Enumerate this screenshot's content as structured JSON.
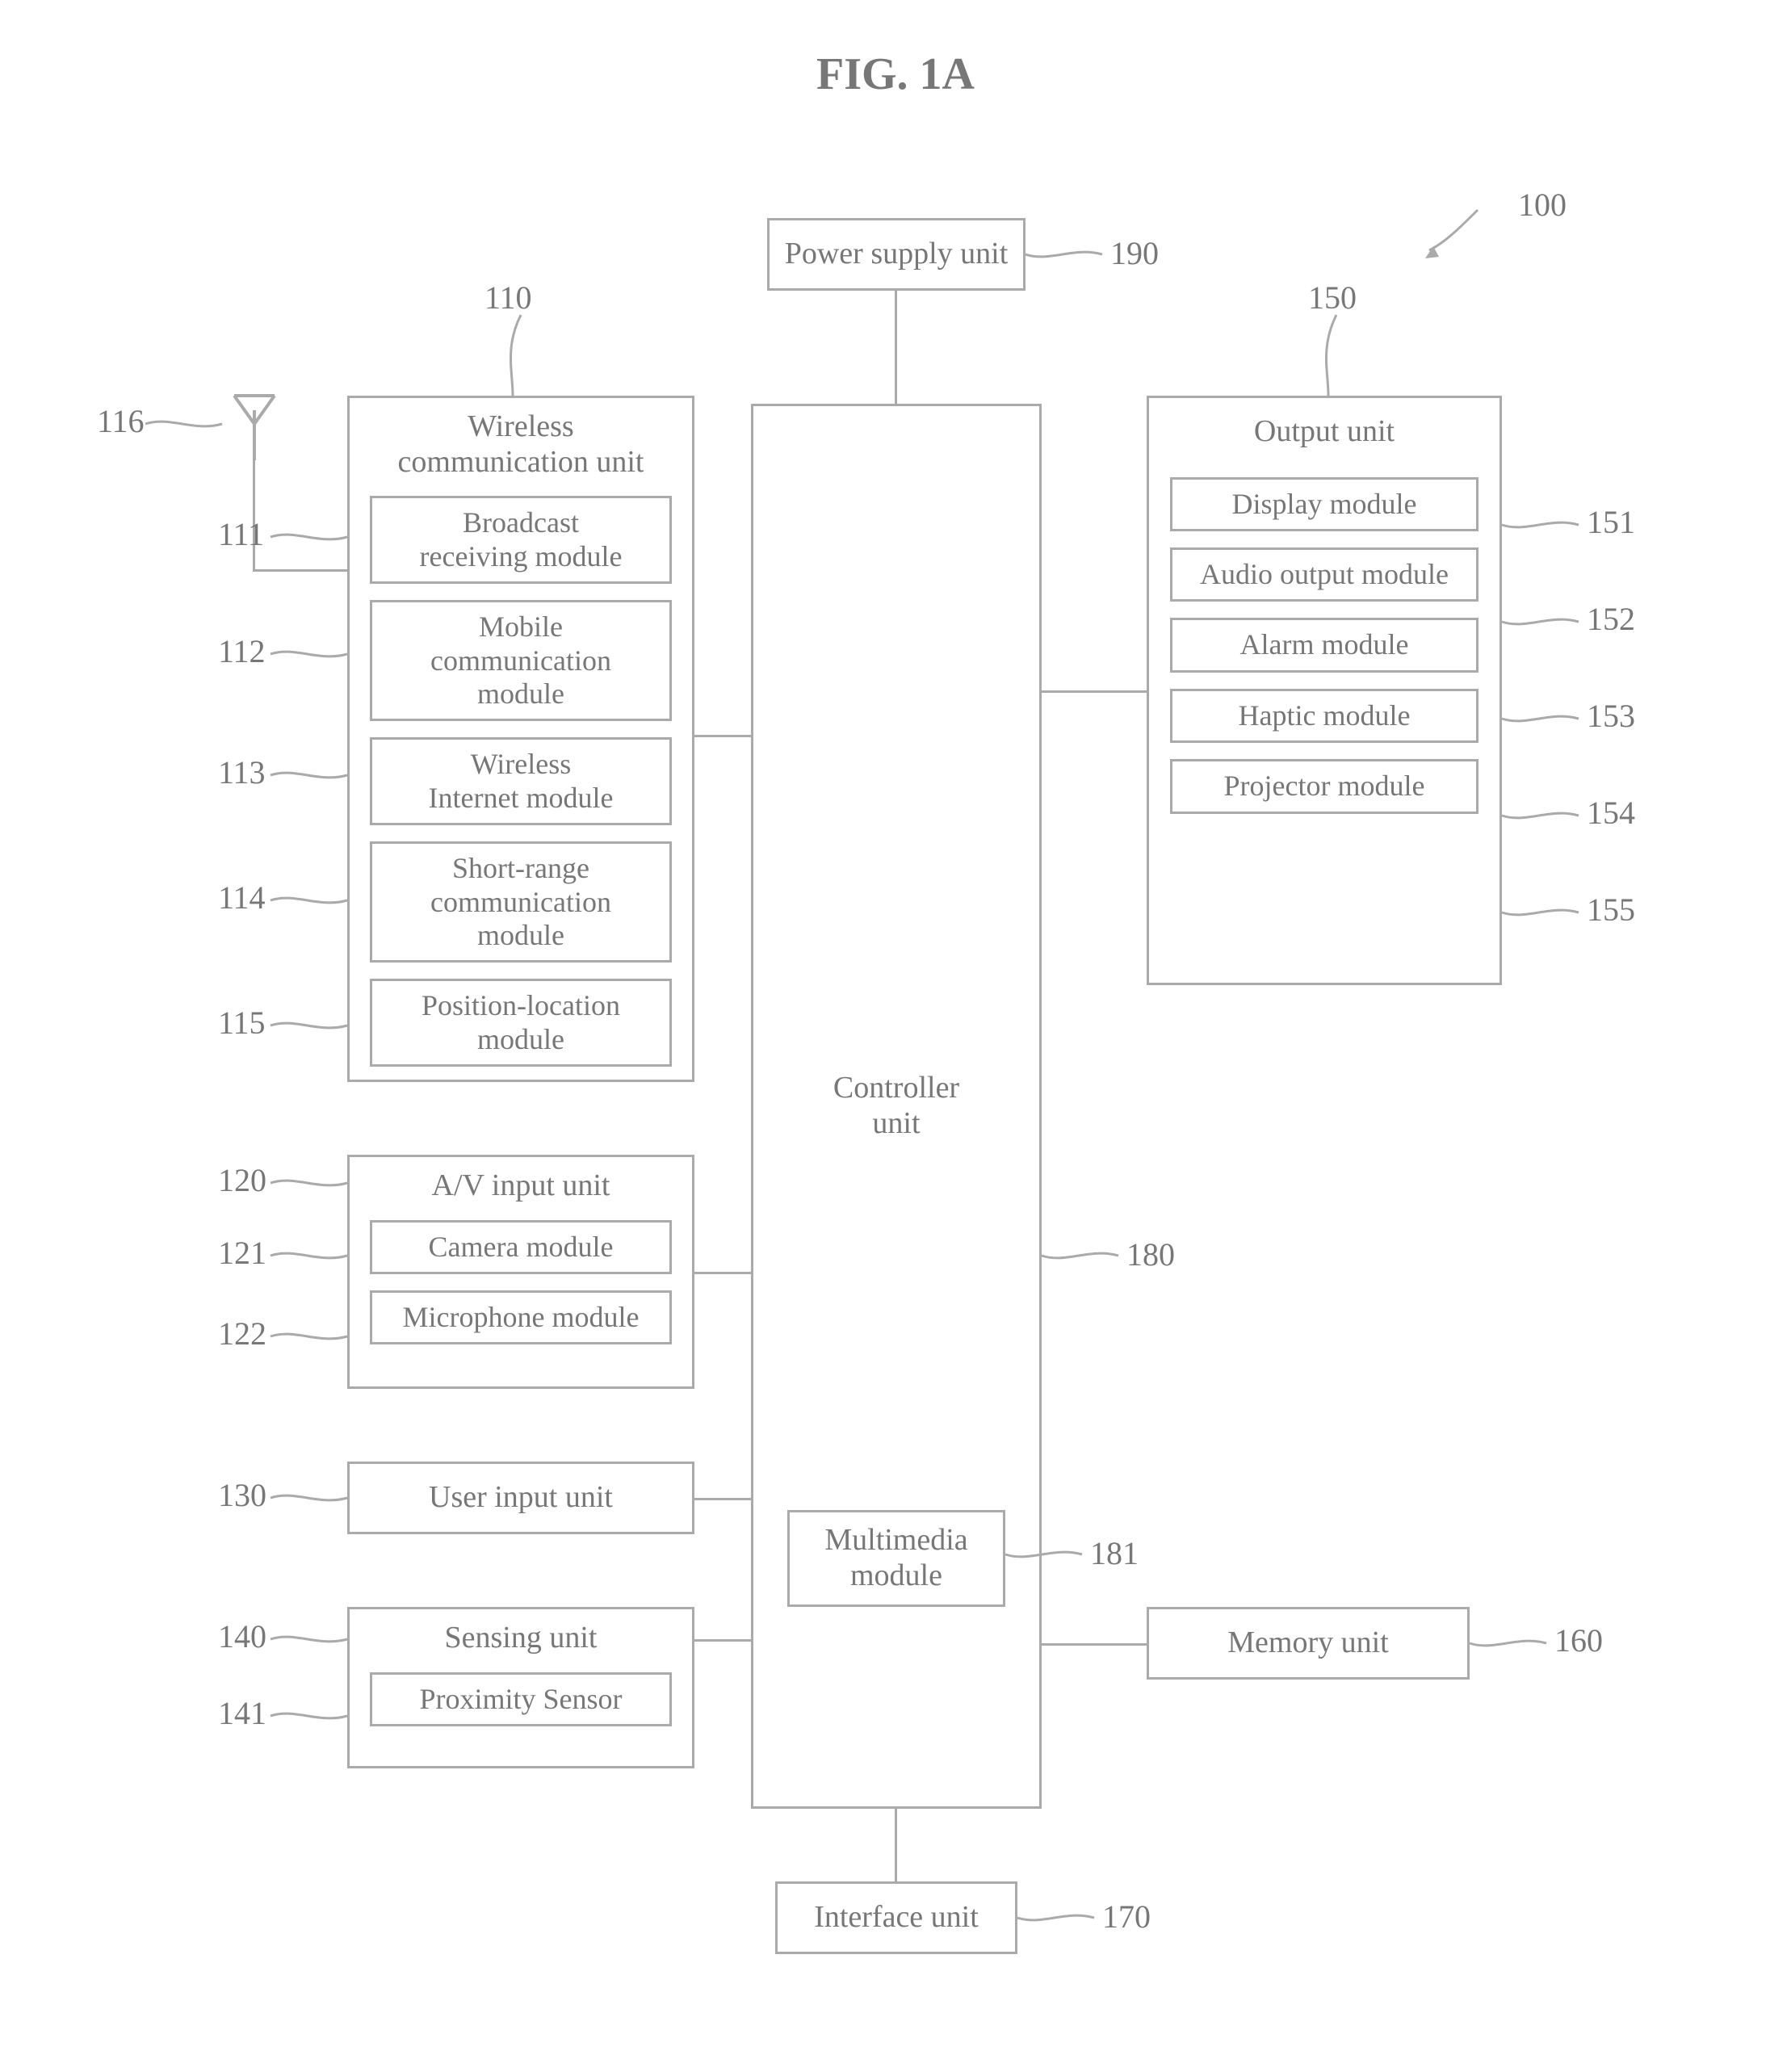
{
  "figure_label": "FIG. 1A",
  "refs": {
    "r100": "100",
    "r190": "190",
    "r110": "110",
    "r116": "116",
    "r111": "111",
    "r112": "112",
    "r113": "113",
    "r114": "114",
    "r115": "115",
    "r120": "120",
    "r121": "121",
    "r122": "122",
    "r130": "130",
    "r140": "140",
    "r141": "141",
    "r150": "150",
    "r151": "151",
    "r152": "152",
    "r153": "153",
    "r154": "154",
    "r155": "155",
    "r160": "160",
    "r170": "170",
    "r180": "180",
    "r181": "181"
  },
  "blocks": {
    "power": "Power supply unit",
    "controller": "Controller\nunit",
    "multimedia": "Multimedia\nmodule",
    "interface": "Interface unit",
    "memory": "Memory unit",
    "wireless_title": "Wireless\ncommunication unit",
    "wireless_items": {
      "broadcast": "Broadcast\nreceiving module",
      "mobile": "Mobile\ncommunication\nmodule",
      "internet": "Wireless\nInternet module",
      "short": "Short-range\ncommunication\nmodule",
      "position": "Position-location\nmodule"
    },
    "av_title": "A/V input unit",
    "av_items": {
      "camera": "Camera module",
      "mic": "Microphone module"
    },
    "user_input": "User input unit",
    "sensing_title": "Sensing unit",
    "sensing_items": {
      "prox": "Proximity Sensor"
    },
    "output_title": "Output unit",
    "output_items": {
      "display": "Display module",
      "audio": "Audio output module",
      "alarm": "Alarm module",
      "haptic": "Haptic module",
      "projector": "Projector module"
    }
  }
}
